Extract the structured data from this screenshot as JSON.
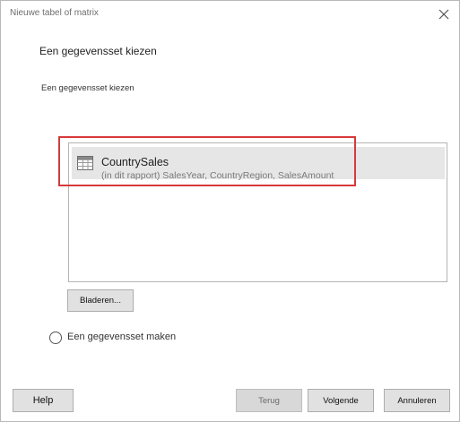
{
  "window": {
    "title": "Nieuwe tabel of matrix"
  },
  "page": {
    "heading": "Een gegevensset kiezen",
    "subheading": "Een gegevensset kiezen"
  },
  "datasets": [
    {
      "name": "CountrySales",
      "description": "(in dit rapport) SalesYear, CountryRegion, SalesAmount",
      "icon": "table-icon"
    }
  ],
  "actions": {
    "browse_label": "Bladeren...",
    "create_dataset_label": "Een gegevensset maken"
  },
  "footer": {
    "help_label": "Help",
    "back_label": "Terug",
    "next_label": "Volgende",
    "cancel_label": "Annuleren"
  },
  "colors": {
    "highlight": "#d9383a",
    "selected_item_bg": "#e6e6e6"
  }
}
